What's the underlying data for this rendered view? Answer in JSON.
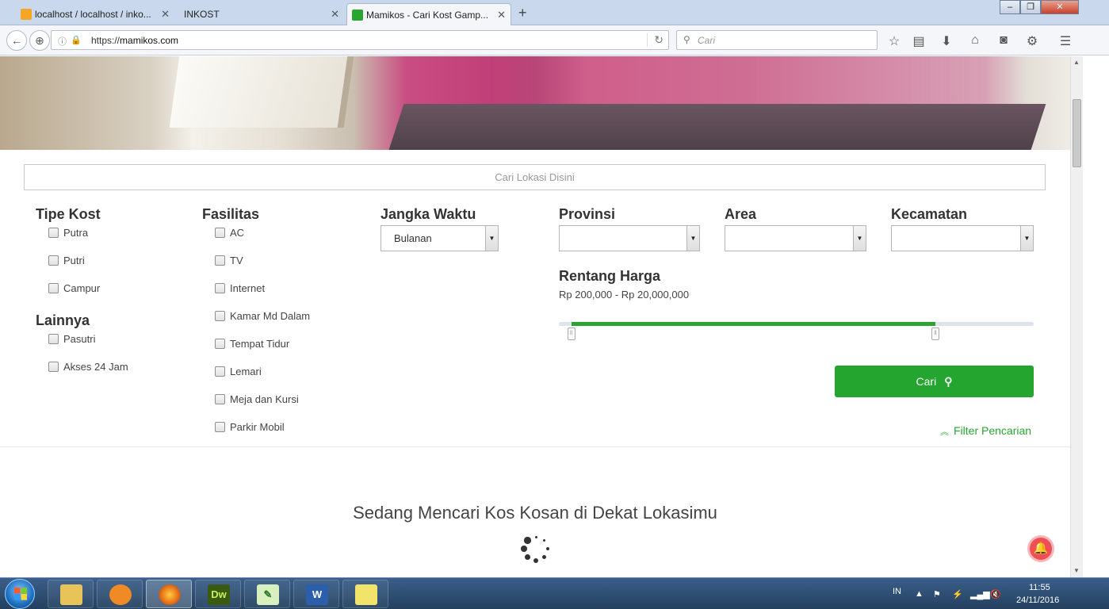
{
  "browser": {
    "tabs": [
      {
        "title": "localhost / localhost / inko...",
        "active": false
      },
      {
        "title": "INKOST",
        "active": false
      },
      {
        "title": "Mamikos - Cari Kost Gamp...",
        "active": true
      }
    ],
    "url_prefix": "https://",
    "url_domain": "mamikos.com",
    "search_placeholder": "Cari"
  },
  "search": {
    "location_placeholder": "Cari Lokasi Disini"
  },
  "filters": {
    "tipe_kost": {
      "heading": "Tipe Kost",
      "options": [
        "Putra",
        "Putri",
        "Campur"
      ]
    },
    "lainnya": {
      "heading": "Lainnya",
      "options": [
        "Pasutri",
        "Akses 24 Jam"
      ]
    },
    "fasilitas": {
      "heading": "Fasilitas",
      "options": [
        "AC",
        "TV",
        "Internet",
        "Kamar Md Dalam",
        "Tempat Tidur",
        "Lemari",
        "Meja dan Kursi",
        "Parkir Mobil"
      ]
    },
    "jangka_waktu": {
      "heading": "Jangka Waktu",
      "value": "Bulanan"
    },
    "provinsi": {
      "heading": "Provinsi",
      "value": ""
    },
    "area": {
      "heading": "Area",
      "value": ""
    },
    "kecamatan": {
      "heading": "Kecamatan",
      "value": ""
    },
    "rentang_harga": {
      "heading": "Rentang Harga",
      "label": "Rp 200,000 - Rp 20,000,000",
      "fill_start_fraction": 0.026,
      "fill_end_fraction": 0.793
    },
    "submit_label": "Cari",
    "filter_toggle_label": "Filter Pencarian"
  },
  "status": {
    "message": "Sedang Mencari Kos Kosan di Dekat Lokasimu"
  },
  "taskbar": {
    "apps": [
      "explorer",
      "uc-browser",
      "firefox",
      "dreamweaver",
      "notepad-plus-plus",
      "word",
      "sticky-notes"
    ],
    "language": "IN",
    "time": "11:55",
    "date": "24/11/2016"
  },
  "colors": {
    "accent_green": "#23a530",
    "notif_red": "#ef4e56"
  }
}
